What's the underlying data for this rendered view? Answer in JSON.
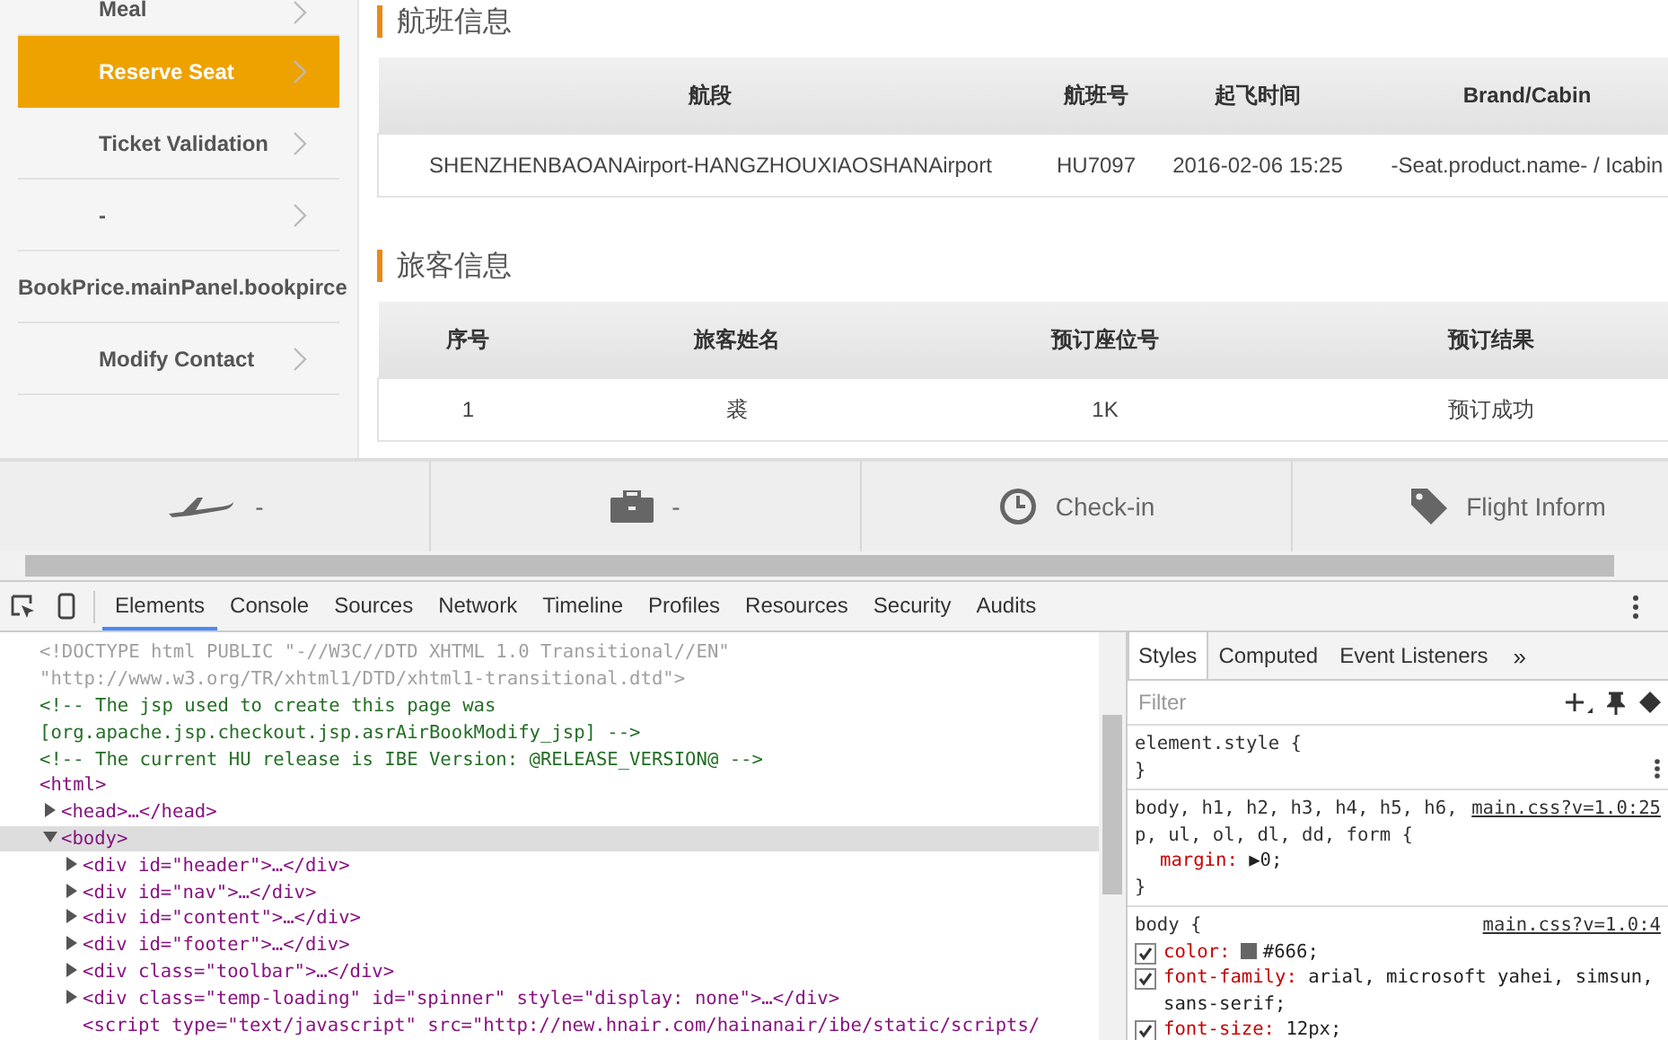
{
  "sidebar": {
    "items": [
      {
        "label": "Meal",
        "selected": false,
        "chevron": true
      },
      {
        "label": "Reserve Seat",
        "selected": true,
        "chevron": true
      },
      {
        "label": "Ticket Validation",
        "selected": false,
        "chevron": true
      },
      {
        "label": "-",
        "selected": false,
        "chevron": true
      },
      {
        "label": "BookPrice.mainPanel.bookpirce",
        "selected": false,
        "chevron": false
      },
      {
        "label": "Modify Contact",
        "selected": false,
        "chevron": true
      }
    ]
  },
  "sections": [
    {
      "title": "航班信息",
      "columns": [
        "航段",
        "航班号",
        "起飞时间",
        "Brand/Cabin"
      ],
      "rows": [
        [
          "SHENZHENBAOANAirport-HANGZHOUXIAOSHANAirport",
          "HU7097",
          "2016-02-06 15:25",
          "-Seat.product.name- / Icabin"
        ]
      ]
    },
    {
      "title": "旅客信息",
      "columns": [
        "序号",
        "旅客姓名",
        "预订座位号",
        "预订结果"
      ],
      "rows": [
        [
          "1",
          "裘",
          "1K",
          "预订成功"
        ]
      ]
    }
  ],
  "bottom_nav": [
    {
      "kind": "plane",
      "label": "-"
    },
    {
      "kind": "briefcase",
      "label": "-"
    },
    {
      "kind": "clock",
      "label": "Check-in"
    },
    {
      "kind": "tag",
      "label": "Flight Inform"
    }
  ],
  "devtools": {
    "tabs": [
      {
        "label": "Elements",
        "selected": true
      },
      {
        "label": "Console",
        "selected": false
      },
      {
        "label": "Sources",
        "selected": false
      },
      {
        "label": "Network",
        "selected": false
      },
      {
        "label": "Timeline",
        "selected": false
      },
      {
        "label": "Profiles",
        "selected": false
      },
      {
        "label": "Resources",
        "selected": false
      },
      {
        "label": "Security",
        "selected": false
      },
      {
        "label": "Audits",
        "selected": false
      }
    ],
    "dom_tree": [
      {
        "kind": "doctype",
        "text": "<!DOCTYPE html PUBLIC \"-//W3C//DTD XHTML 1.0 Transitional//EN\""
      },
      {
        "kind": "doctype",
        "text": "\"http://www.w3.org/TR/xhtml1/DTD/xhtml1-transitional.dtd\">"
      },
      {
        "kind": "comment",
        "text": "<!-- The jsp used to create this page was"
      },
      {
        "kind": "comment",
        "text": "[org.apache.jsp.checkout.jsp.asrAirBookModify_jsp] -->"
      },
      {
        "kind": "comment",
        "text": "<!-- The current HU release is IBE Version: @RELEASE_VERSION@ -->"
      },
      {
        "kind": "tag",
        "text": "<html>",
        "children": [
          {
            "kind": "tag",
            "text": "<head>…</head>",
            "expanded": false,
            "selected": false
          },
          {
            "kind": "tag",
            "text": "<body>",
            "expanded": true,
            "selected": true,
            "children": [
              {
                "kind": "tag",
                "text": "<div id=\"header\">…</div>",
                "expanded": false,
                "selected": false
              },
              {
                "kind": "tag",
                "text": "<div id=\"nav\">…</div>",
                "expanded": false,
                "selected": false
              },
              {
                "kind": "tag",
                "text": "<div id=\"content\">…</div>",
                "expanded": false,
                "selected": false
              },
              {
                "kind": "tag",
                "text": "<div id=\"footer\">…</div>",
                "expanded": false,
                "selected": false
              },
              {
                "kind": "tag",
                "text": "<div class=\"toolbar\">…</div>",
                "expanded": false,
                "selected": false
              },
              {
                "kind": "tag",
                "text": "<div class=\"temp-loading\" id=\"spinner\" style=\"display: none\">…</div>",
                "expanded": false,
                "selected": false
              },
              {
                "kind": "tag",
                "text": "<script type=\"text/javascript\" src=\"http://new.hnair.com/hainanair/ibe/static/scripts/"
              }
            ]
          }
        ]
      }
    ],
    "side_tabs": [
      {
        "label": "Styles",
        "selected": true
      },
      {
        "label": "Computed",
        "selected": false
      },
      {
        "label": "Event Listeners",
        "selected": false
      }
    ],
    "side_more": "»",
    "filter": {
      "placeholder": "Filter"
    },
    "rules": [
      {
        "selector": "element.style {",
        "close": "}"
      },
      {
        "selector": "body, h1, h2, h3, h4, h5, h6, p, ul, ol, dl, dd, form {",
        "source": "main.css?v=1.0:25",
        "props": [
          {
            "kind": "plain",
            "name": "margin:",
            "value": "▶0;"
          }
        ],
        "close": "}"
      },
      {
        "selector": "body {",
        "source": "main.css?v=1.0:4",
        "props": [
          {
            "kind": "check",
            "name": "color:",
            "value": "#666;",
            "checked": true,
            "color": "#666666"
          },
          {
            "kind": "check",
            "name": "font-family:",
            "value": "arial, microsoft yahei, simsun, sans-serif;",
            "checked": true
          },
          {
            "kind": "check",
            "name": "font-size:",
            "value": "12px;",
            "checked": true
          }
        ]
      }
    ]
  }
}
